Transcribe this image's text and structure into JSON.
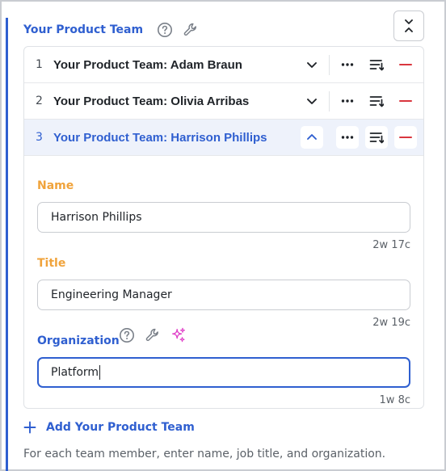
{
  "field": {
    "title": "Your Product Team",
    "icons": [
      "help-icon",
      "wrench-icon"
    ],
    "collapse_icon": "collapse-icon"
  },
  "items": [
    {
      "index": "1",
      "label": "Your Product Team: Adam Braun",
      "expanded": false
    },
    {
      "index": "2",
      "label": "Your Product Team: Olivia Arribas",
      "expanded": false
    },
    {
      "index": "3",
      "label": "Your Product Team: Harrison Phillips",
      "expanded": true
    }
  ],
  "row_icons": [
    "chevron-down-icon",
    "more-icon",
    "reorder-icon",
    "remove-icon"
  ],
  "expanded_item": {
    "name": {
      "label": "Name",
      "value": "Harrison Phillips",
      "meta": "2w 17c"
    },
    "title": {
      "label": "Title",
      "value": "Engineering Manager",
      "meta": "2w 19c"
    },
    "organization": {
      "label": "Organization",
      "value": "Platform",
      "meta": "1w 8c",
      "icons": [
        "help-icon",
        "wrench-icon",
        "sparkle-icon"
      ]
    }
  },
  "add_button": {
    "label": "Add Your Product Team",
    "icon": "plus-icon"
  },
  "help_text": "For each team member, enter name, job title, and organization.",
  "colors": {
    "accent": "#2f5fd0",
    "label_orange": "#f0a33b",
    "remove_red": "#d9363e",
    "sparkle_pink": "#e040c8"
  }
}
